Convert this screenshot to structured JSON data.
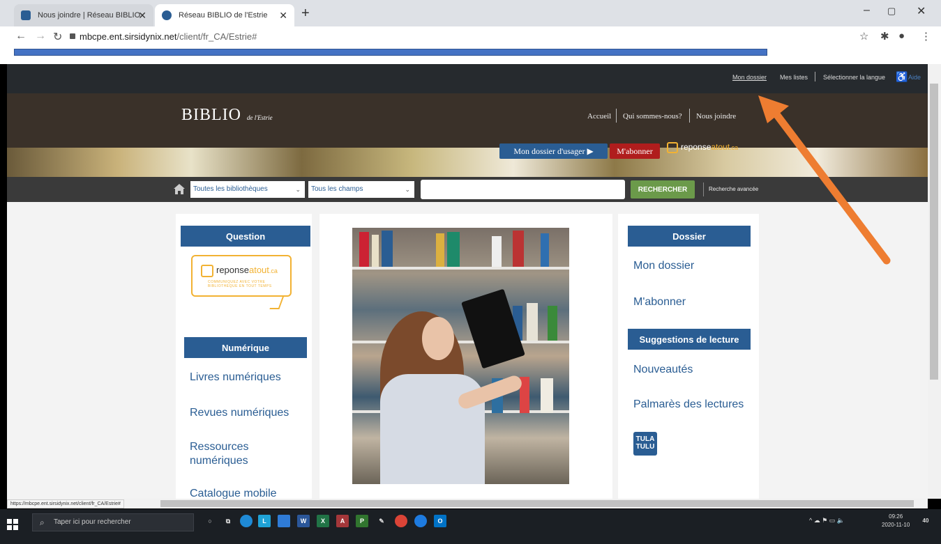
{
  "browser": {
    "tabs": [
      {
        "title": "Nous joindre | Réseau BIBLIO de l'Estrie",
        "active": false
      },
      {
        "title": "Réseau BIBLIO de l'Estrie",
        "active": true
      }
    ],
    "new_tab": "+",
    "url_host": "mbcpe.ent.sirsidynix.net",
    "url_path": "/client/fr_CA/Estrie#",
    "status_url": "https://mbcpe.ent.sirsidynix.net/client/fr_CA/Estrie#"
  },
  "util_bar": {
    "mon_dossier": "Mon dossier",
    "mes_listes": "Mes listes",
    "langue": "Sélectionner la langue",
    "aide": "Aide"
  },
  "header": {
    "logo_main": "BIBLIO",
    "logo_sub": "de l'Estrie",
    "nav": [
      "Accueil",
      "Qui sommes-nous?",
      "Nous joindre"
    ],
    "btn_dossier": "Mon dossier d'usager ▶",
    "btn_abonner": "M'abonner",
    "ra_logo_a": "reponse",
    "ra_logo_b": "atout",
    "ra_logo_c": ".ca"
  },
  "search": {
    "library_select": "Toutes les bibliothèques",
    "field_select": "Tous les champs",
    "query": "",
    "button": "RECHERCHER",
    "advanced": "Recherche avancée"
  },
  "left_col": {
    "question_heading": "Question",
    "ra_card_a": "reponse",
    "ra_card_b": "atout",
    "ra_card_c": ".ca",
    "ra_card_sub1": "COMMUNIQUEZ AVEC VOTRE",
    "ra_card_sub2": "BIBLIOTHÈQUE EN TOUT TEMPS",
    "numerique_heading": "Numérique",
    "links": [
      "Livres numériques",
      "Revues numériques",
      "Ressources numériques",
      "Catalogue mobile"
    ]
  },
  "right_col": {
    "dossier_heading": "Dossier",
    "dossier_links": [
      "Mon dossier",
      "M'abonner"
    ],
    "suggestions_heading": "Suggestions de lecture",
    "suggestions_links": [
      "Nouveautés",
      "Palmarès des lectures"
    ],
    "tula_a": "TULA",
    "tula_b": "TULU"
  },
  "taskbar": {
    "search_placeholder": "Taper ici pour rechercher",
    "time": "09:26",
    "date": "2020-11-10",
    "notif": "40"
  },
  "colors": {
    "brand_blue": "#2a5d93",
    "accent_red": "#b01d1d",
    "accent_orange": "#f2b233",
    "arrow_orange": "#ee7d31",
    "search_green": "#6b9a4a"
  }
}
